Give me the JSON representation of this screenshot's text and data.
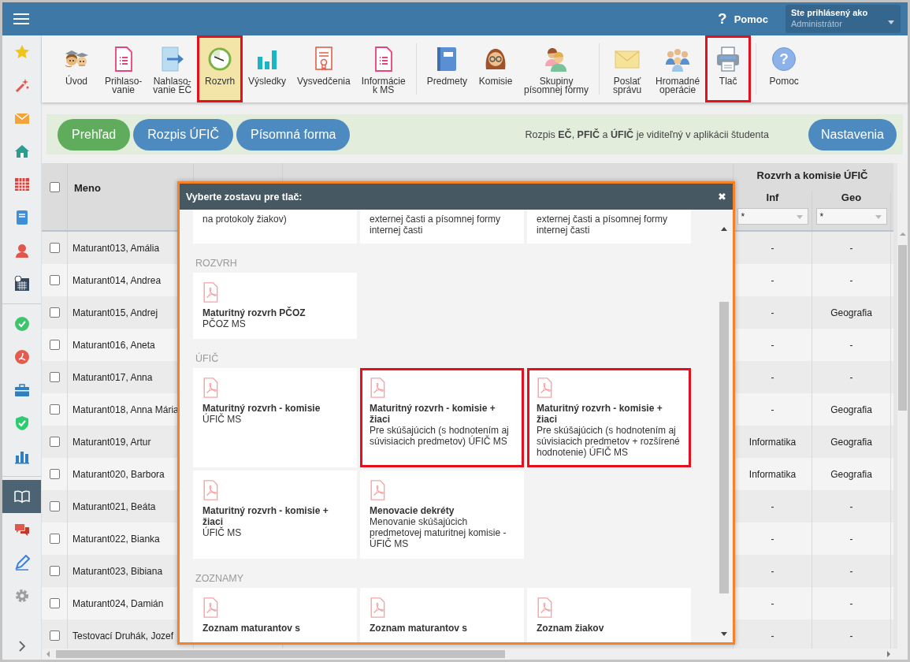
{
  "topbar": {
    "help_glyph": "?",
    "help_label": "Pomoc",
    "user_caption": "Ste prihlásený ako",
    "user_name": "Administrátor"
  },
  "sidebar": {
    "items": [
      {
        "selected": false
      },
      {
        "selected": false
      },
      {
        "selected": false
      },
      {
        "selected": false
      },
      {
        "selected": false
      },
      {
        "selected": false
      },
      {
        "selected": false
      },
      {
        "selected": false
      },
      {
        "selected": false
      },
      {
        "selected": false
      },
      {
        "selected": false
      },
      {
        "selected": false
      },
      {
        "selected": false
      },
      {
        "selected": true
      },
      {
        "selected": false
      },
      {
        "selected": false
      },
      {
        "selected": false
      }
    ]
  },
  "toolbar": {
    "groups": [
      {
        "items": [
          {
            "label": "Úvod",
            "selected": false,
            "highlighted": false
          },
          {
            "label": "Prihlaso-\nvanie",
            "selected": false,
            "highlighted": false
          },
          {
            "label": "Nahlaso-\nvanie EČ",
            "selected": false,
            "highlighted": false
          },
          {
            "label": "Rozvrh",
            "selected": true,
            "highlighted": true
          },
          {
            "label": "Výsledky",
            "selected": false,
            "highlighted": false
          },
          {
            "label": "Vysvedčenia",
            "selected": false,
            "highlighted": false
          },
          {
            "label": "Informácie\nk MS",
            "selected": false,
            "highlighted": false
          }
        ]
      },
      {
        "items": [
          {
            "label": "Predmety",
            "selected": false,
            "highlighted": false
          },
          {
            "label": "Komisie",
            "selected": false,
            "highlighted": false
          },
          {
            "label": "Skupiny\npísomnej formy",
            "selected": false,
            "highlighted": false
          }
        ]
      },
      {
        "items": [
          {
            "label": "Poslať\nsprávu",
            "selected": false,
            "highlighted": false
          },
          {
            "label": "Hromadné\noperácie",
            "selected": false,
            "highlighted": false
          },
          {
            "label": "Tlač",
            "selected": false,
            "highlighted": true
          }
        ]
      },
      {
        "items": [
          {
            "label": "Pomoc",
            "glyph": "?",
            "selected": false,
            "highlighted": false
          }
        ]
      }
    ]
  },
  "tabs": [
    {
      "label": "Prehľad",
      "selected": true
    },
    {
      "label": "Rozpis ÚFIČ",
      "selected": false
    },
    {
      "label": "Písomná forma",
      "selected": false
    }
  ],
  "info_text": "Rozpis **EČ**, **PFIČ** a **ÚFIČ** je viditeľný v aplikácii študenta",
  "settings_button": "Nastavenia",
  "table": {
    "header_checked": false,
    "name_header": "Meno",
    "group_header": "Rozvrh a komisie ÚFIČ",
    "subcolumns": [
      {
        "label": "Inf",
        "filter": "*"
      },
      {
        "label": "Geo",
        "filter": "*"
      }
    ],
    "rows": [
      {
        "name": "Maturant013, Amália",
        "checked": false,
        "inf": "-",
        "geo": "-"
      },
      {
        "name": "Maturant014, Andrea",
        "checked": false,
        "inf": "-",
        "geo": "-"
      },
      {
        "name": "Maturant015, Andrej",
        "checked": false,
        "inf": "-",
        "geo": "Geografia"
      },
      {
        "name": "Maturant016, Aneta",
        "checked": false,
        "inf": "-",
        "geo": "-"
      },
      {
        "name": "Maturant017, Anna",
        "checked": false,
        "inf": "-",
        "geo": "-"
      },
      {
        "name": "Maturant018, Anna Mária",
        "checked": false,
        "inf": "-",
        "geo": "Geografia"
      },
      {
        "name": "Maturant019, Artur",
        "checked": false,
        "inf": "Informatika",
        "geo": "Geografia"
      },
      {
        "name": "Maturant020, Barbora",
        "checked": false,
        "inf": "Informatika",
        "geo": "Geografia"
      },
      {
        "name": "Maturant021, Beáta",
        "checked": false,
        "inf": "-",
        "geo": "-"
      },
      {
        "name": "Maturant022, Bianka",
        "checked": false,
        "inf": "-",
        "geo": "-"
      },
      {
        "name": "Maturant023, Bibiana",
        "checked": false,
        "inf": "-",
        "geo": "-"
      },
      {
        "name": "Maturant024, Damián",
        "checked": false,
        "inf": "-",
        "geo": "-"
      },
      {
        "name": "Testovací Druhák, Jozef",
        "checked": false,
        "inf": "-",
        "geo": "-"
      }
    ]
  },
  "dialog": {
    "title": "Vyberte zostavu pre tlač:",
    "close": "✖",
    "sections": [
      {
        "cards": [
          {
            "description": "na protokoly žiakov)",
            "highlighted": false
          },
          {
            "description": "externej časti a písomnej formy internej časti",
            "highlighted": false
          },
          {
            "description": "externej časti a písomnej formy internej časti",
            "highlighted": false
          }
        ]
      },
      {
        "heading": "ROZVRH",
        "cards": [
          {
            "title": "Maturitný rozvrh PČOZ",
            "description": "PČOZ MS",
            "highlighted": false
          }
        ]
      },
      {
        "heading": "ÚFIČ",
        "cards": [
          {
            "title": "Maturitný rozvrh - komisie",
            "description": "ÚFIČ MS",
            "highlighted": false
          },
          {
            "title": "Maturitný rozvrh - komisie + žiaci",
            "description": "Pre skúšajúcich (s hodnotením aj súvisiacich predmetov) ÚFIČ MS",
            "highlighted": true
          },
          {
            "title": "Maturitný rozvrh - komisie + žiaci",
            "description": "Pre skúšajúcich (s hodnotením aj súvisiacich predmetov + rozšírené hodnotenie) ÚFIČ MS",
            "highlighted": true
          },
          {
            "title": "Maturitný rozvrh - komisie + žiaci",
            "description": "ÚFIČ MS",
            "highlighted": false
          },
          {
            "title": "Menovacie dekréty",
            "description": "Menovanie skúšajúcich predmetovej maturitnej komisie - ÚFIČ MS",
            "highlighted": false
          }
        ]
      },
      {
        "heading": "ZOZNAMY",
        "cards": [
          {
            "title": "Zoznam maturantov s",
            "highlighted": false
          },
          {
            "title": "Zoznam maturantov s",
            "highlighted": false
          },
          {
            "title": "Zoznam žiakov",
            "highlighted": false
          }
        ]
      }
    ]
  }
}
